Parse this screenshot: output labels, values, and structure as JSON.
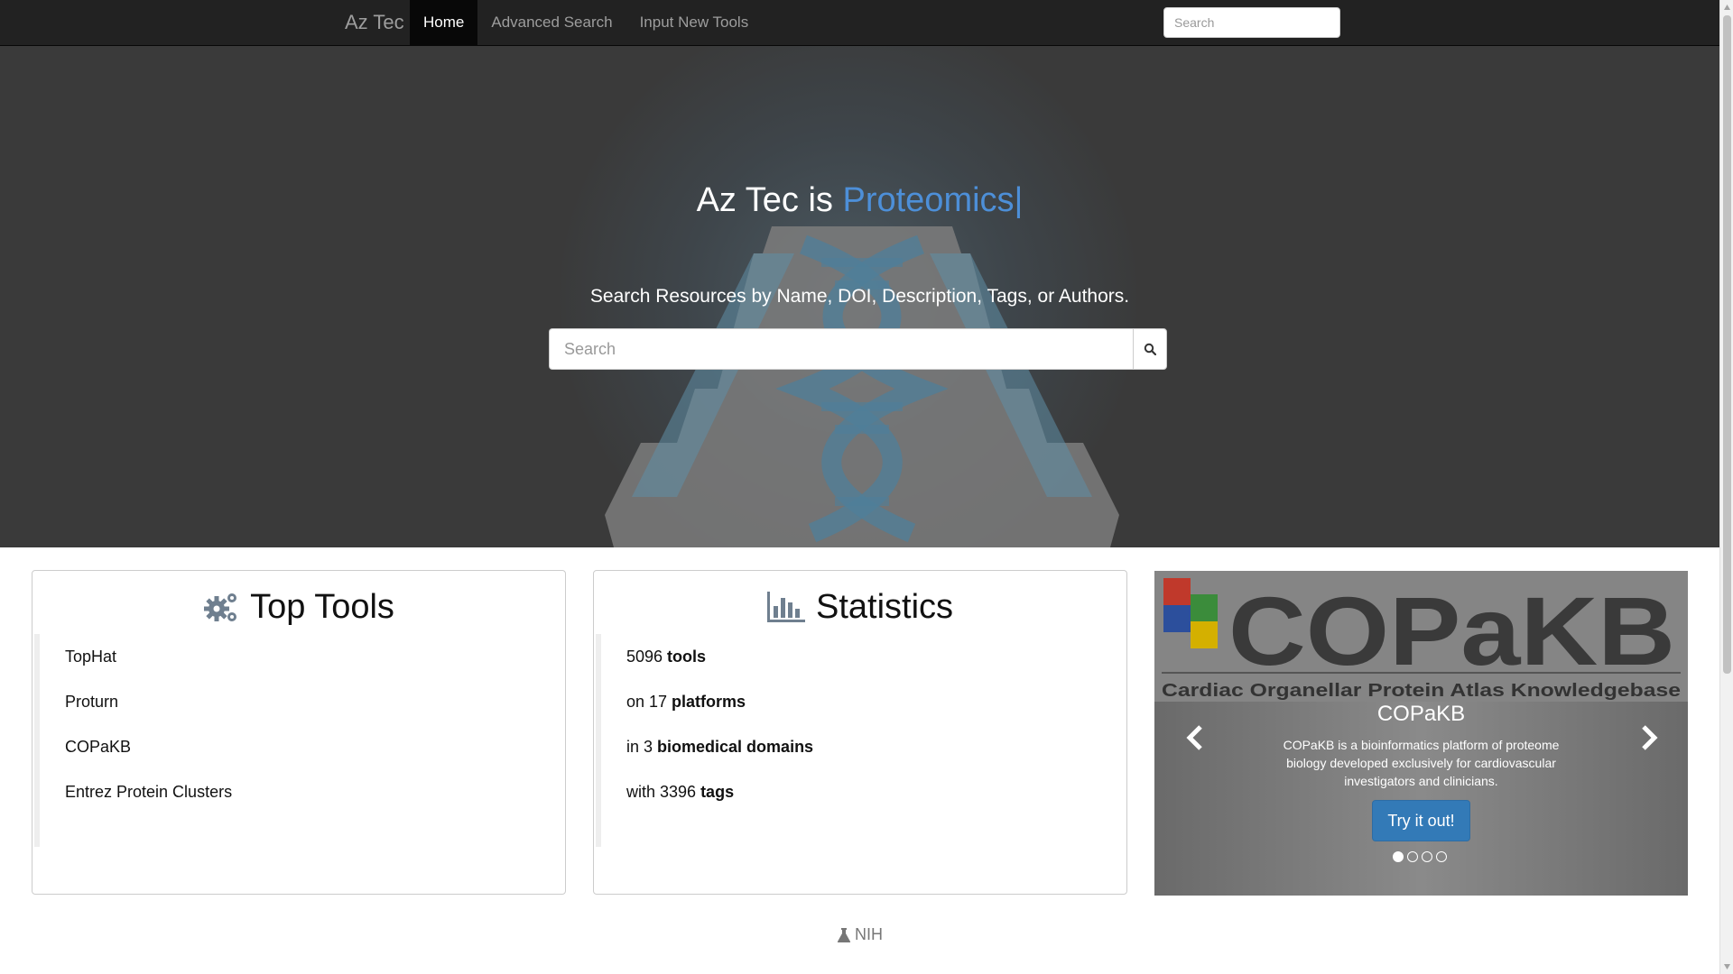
{
  "navbar": {
    "brand": "Az Tec",
    "items": [
      {
        "label": "Home",
        "active": true
      },
      {
        "label": "Advanced Search",
        "active": false
      },
      {
        "label": "Input New Tools",
        "active": false
      }
    ],
    "search_placeholder": "Search"
  },
  "hero": {
    "title_prefix": "Az Tec is ",
    "title_rotator": "Proteomics",
    "caret": "|",
    "subtitle": "Search Resources by Name, DOI, Description, Tags, or Authors.",
    "search_placeholder": "Search",
    "search_icon": "search-icon"
  },
  "top_tools": {
    "title": "Top Tools",
    "icon": "gears-icon",
    "items": [
      "TopHat",
      "Proturn",
      "COPaKB",
      "Entrez Protein Clusters"
    ]
  },
  "statistics": {
    "title": "Statistics",
    "icon": "bar-chart-icon",
    "items": [
      {
        "pre": "5096 ",
        "bold": "tools"
      },
      {
        "pre": "on 17 ",
        "bold": "platforms"
      },
      {
        "pre": "in 3 ",
        "bold": "biomedical domains"
      },
      {
        "pre": "with 3396 ",
        "bold": "tags"
      }
    ]
  },
  "carousel": {
    "image_logo_text": "COPaKB",
    "image_logo_subtitle": "Cardiac Organellar Protein Atlas Knowledgebase",
    "caption_title": "COPaKB",
    "caption_text": "COPaKB is a bioinformatics platform of proteome biology developed exclusively for cardiovascular investigators and clinicians.",
    "button_label": "Try it out!",
    "slide_count": 4,
    "active_slide": 1
  },
  "footer": {
    "icon": "flask-icon",
    "label": "NIH"
  },
  "colors": {
    "navbar_bg": "#222222",
    "hero_bg": "#3a3a3a",
    "accent": "#4d8fd8",
    "button_primary": "#337ab7"
  }
}
